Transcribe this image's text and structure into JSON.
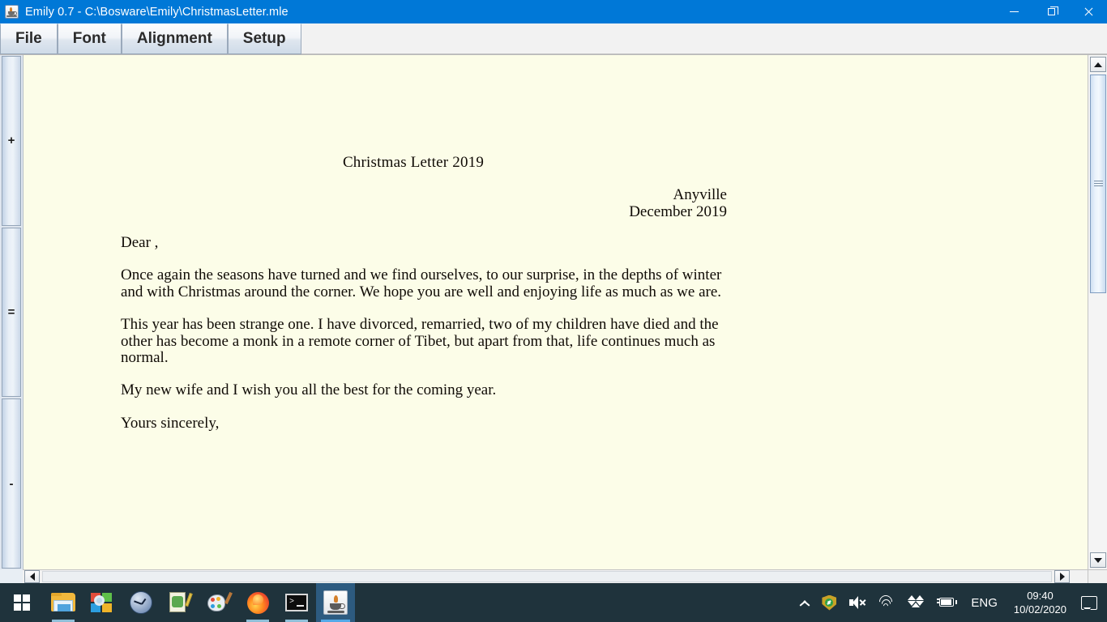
{
  "window": {
    "title": "Emily 0.7 - C:\\Bosware\\Emily\\ChristmasLetter.mle",
    "app_icon": "java-cup-icon",
    "controls": {
      "minimize": "minimize-icon",
      "maximize": "restore-icon",
      "close": "close-icon"
    },
    "titlebar_color": "#0078d7"
  },
  "menubar": {
    "items": [
      {
        "label": "File"
      },
      {
        "label": "Font"
      },
      {
        "label": "Alignment"
      },
      {
        "label": "Setup"
      }
    ]
  },
  "gutter": {
    "buttons": [
      {
        "label": "+",
        "name": "zoom-in-button"
      },
      {
        "label": "=",
        "name": "zoom-reset-button"
      },
      {
        "label": "-",
        "name": "zoom-out-button"
      }
    ]
  },
  "document": {
    "paper_color": "#fcfde8",
    "title": "Christmas Letter 2019",
    "address": [
      "Anyville",
      "December 2019"
    ],
    "salutation": "Dear ,",
    "paragraphs": [
      "Once again the seasons have turned and we find ourselves, to our surprise, in the depths of winter and with Christmas around the corner. We hope you are well and enjoying life as much as we are.",
      "This year has been strange one. I have divorced, remarried, two of my children have died and the other has become a monk in a remote corner of Tibet, but apart from that, life continues much as normal.",
      "My new wife and I wish you all the best for the coming year."
    ],
    "closing": "Yours sincerely,"
  },
  "scrollbars": {
    "vertical": {
      "up": "scroll-up-arrow",
      "down": "scroll-down-arrow"
    },
    "horizontal": {
      "left": "scroll-left-arrow",
      "right": "scroll-right-arrow"
    }
  },
  "taskbar": {
    "background": "#1f333c",
    "items": [
      {
        "name": "start-button",
        "icon": "windows-logo-icon"
      },
      {
        "name": "taskbar-file-explorer",
        "icon": "folder-icon"
      },
      {
        "name": "taskbar-photos",
        "icon": "photos-icon"
      },
      {
        "name": "taskbar-clock-app",
        "icon": "clock-icon"
      },
      {
        "name": "taskbar-notes-app",
        "icon": "notepad-icon"
      },
      {
        "name": "taskbar-paint",
        "icon": "paint-palette-icon"
      },
      {
        "name": "taskbar-firefox",
        "icon": "firefox-icon"
      },
      {
        "name": "taskbar-terminal",
        "icon": "terminal-icon"
      },
      {
        "name": "taskbar-java-app",
        "icon": "java-cup-icon"
      }
    ],
    "tray": {
      "chevron": "show-hidden-icons-chevron",
      "security": "security-shield-icon",
      "volume": "volume-muted-icon",
      "network": "wifi-icon",
      "dropbox": "dropbox-icon",
      "battery": "battery-charging-icon",
      "language": "ENG",
      "time": "09:40",
      "date": "10/02/2020",
      "notifications": "notification-bubble-icon"
    }
  }
}
